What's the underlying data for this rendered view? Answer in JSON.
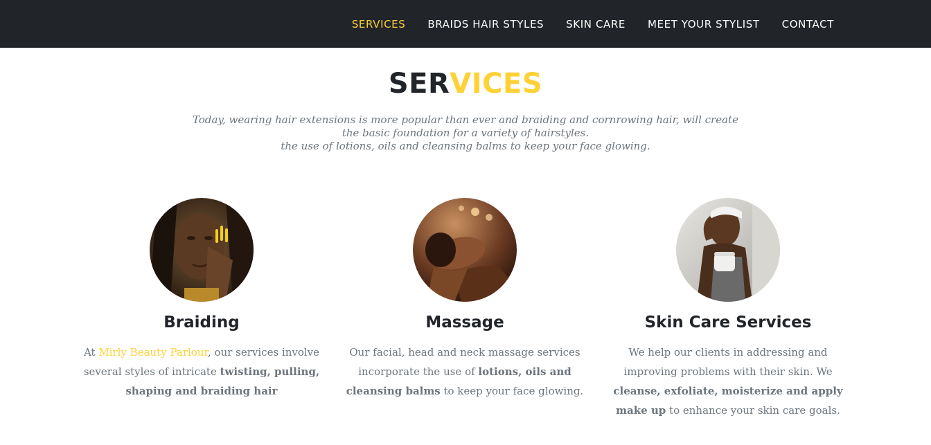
{
  "nav": {
    "items": [
      {
        "label": "SERVICES"
      },
      {
        "label": "BRAIDS HAIR STYLES"
      },
      {
        "label": "SKIN CARE"
      },
      {
        "label": "MEET YOUR STYLIST"
      },
      {
        "label": "CONTACT"
      }
    ]
  },
  "colors": {
    "accent": "#fed136",
    "dark": "#212529",
    "muted": "#6c757d"
  },
  "section": {
    "heading_part_a": "SER",
    "heading_part_b": "VICES",
    "intro_lines": [
      "Today, wearing hair extensions is more popular than ever and braiding and cornrowing hair, will create",
      "the basic foundation for a variety of hairstyles.",
      "the use of lotions, oils and cleansing balms to keep your face glowing."
    ]
  },
  "services": [
    {
      "title": "Braiding",
      "text_1": "At ",
      "brand_link": "Mirly Beauty Parlour",
      "text_2": ", our services involve several styles of intricate ",
      "bold_1": "twisting, pulling, shaping and braiding hair",
      "text_3": ""
    },
    {
      "title": "Massage",
      "text_1": "Our facial, head and neck massage services incorporate the use of ",
      "bold_1": "lotions, oils and cleansing balms",
      "text_2": " to keep your face glowing."
    },
    {
      "title": "Skin Care Services",
      "text_1": "We help our clients in addressing and improving problems with their skin. We ",
      "bold_1": "cleanse, exfoliate, moisterize and apply make up",
      "text_2": " to enhance your skin care goals."
    }
  ]
}
